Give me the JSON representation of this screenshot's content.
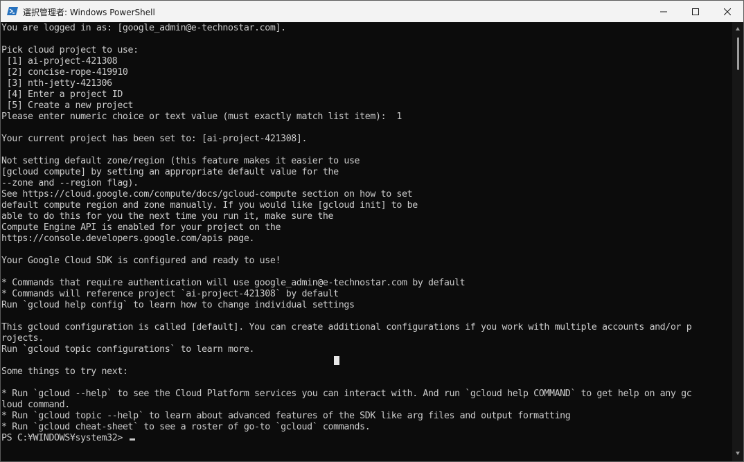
{
  "window": {
    "title": "選択管理者: Windows PowerShell",
    "icon": "powershell-icon",
    "controls": [
      "minimize-icon",
      "maximize-icon",
      "close-icon"
    ]
  },
  "terminal": {
    "lines": [
      "You are logged in as: [google_admin@e-technostar.com].",
      "",
      "Pick cloud project to use:",
      " [1] ai-project-421308",
      " [2] concise-rope-419910",
      " [3] nth-jetty-421306",
      " [4] Enter a project ID",
      " [5] Create a new project",
      "Please enter numeric choice or text value (must exactly match list item):  1",
      "",
      "Your current project has been set to: [ai-project-421308].",
      "",
      "Not setting default zone/region (this feature makes it easier to use",
      "[gcloud compute] by setting an appropriate default value for the",
      "--zone and --region flag).",
      "See https://cloud.google.com/compute/docs/gcloud-compute section on how to set",
      "default compute region and zone manually. If you would like [gcloud init] to be",
      "able to do this for you the next time you run it, make sure the",
      "Compute Engine API is enabled for your project on the",
      "https://console.developers.google.com/apis page.",
      "",
      "Your Google Cloud SDK is configured and ready to use!",
      "",
      "* Commands that require authentication will use google_admin@e-technostar.com by default",
      "* Commands will reference project `ai-project-421308` by default",
      "Run `gcloud help config` to learn how to change individual settings",
      "",
      "This gcloud configuration is called [default]. You can create additional configurations if you work with multiple accounts and/or p",
      "rojects.",
      "Run `gcloud topic configurations` to learn more.",
      "",
      "Some things to try next:",
      "",
      "* Run `gcloud --help` to see the Cloud Platform services you can interact with. And run `gcloud help COMMAND` to get help on any gc",
      "loud command.",
      "* Run `gcloud topic --help` to learn about advanced features of the SDK like arg files and output formatting",
      "* Run `gcloud cheat-sheet` to see a roster of go-to `gcloud` commands."
    ],
    "prompt": "PS C:¥WINDOWS¥system32> "
  },
  "colors": {
    "terminal_bg": "#0c0c0c",
    "terminal_fg": "#cccccc",
    "titlebar_bg": "#f3f3f3",
    "powershell_blue": "#2671be"
  }
}
